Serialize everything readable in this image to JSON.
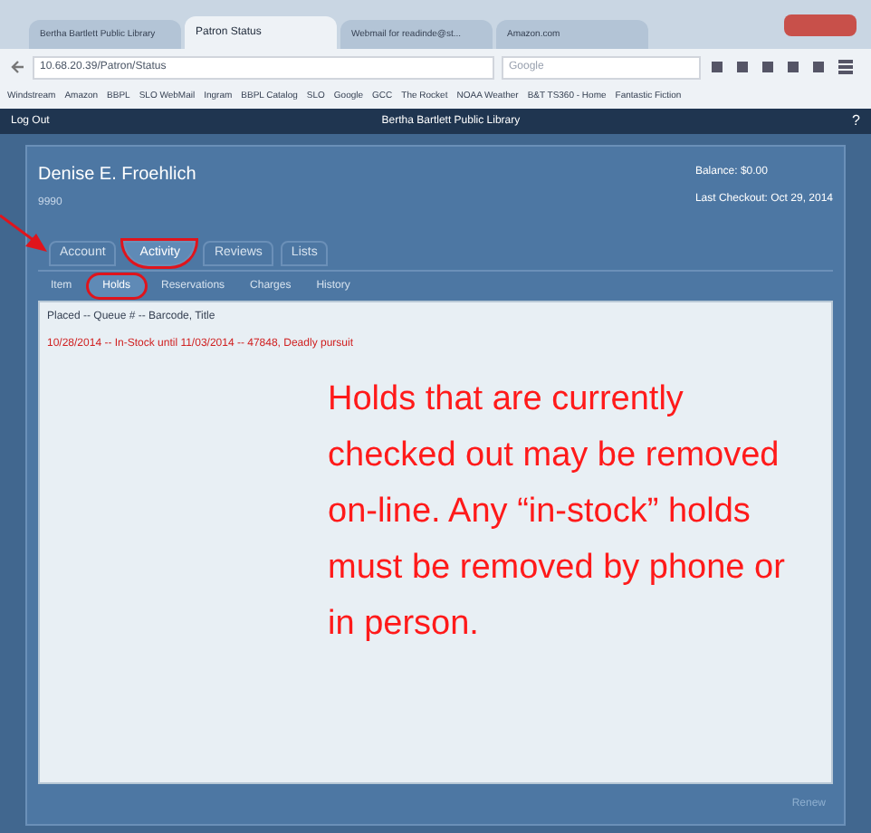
{
  "browser": {
    "tabs": [
      {
        "label": "Bertha Bartlett Public Library",
        "selected": false
      },
      {
        "label": "Patron Status",
        "selected": true
      },
      {
        "label": "Webmail for readinde@st...",
        "selected": false
      },
      {
        "label": "Amazon.com",
        "selected": false
      }
    ],
    "address": "10.68.20.39/Patron/Status",
    "search_placeholder": "Google",
    "bookmarks": [
      "Windstream",
      "Amazon",
      "BBPL",
      "SLO WebMail",
      "Ingram",
      "BBPL Catalog",
      "SLO",
      "Google",
      "GCC",
      "The Rocket",
      "NOAA Weather",
      "B&T TS360 - Home",
      "Fantastic Fiction"
    ]
  },
  "app_bar": {
    "logout": "Log Out",
    "title": "Bertha Bartlett Public Library",
    "help": "?"
  },
  "patron": {
    "name": "Denise E. Froehlich",
    "id": "9990",
    "balance": "Balance: $0.00",
    "last_checkout": "Last Checkout: Oct 29, 2014"
  },
  "tabs": [
    {
      "label": "Account",
      "selected": false,
      "circled": false
    },
    {
      "label": "Activity",
      "selected": true,
      "circled": true
    },
    {
      "label": "Reviews",
      "selected": false,
      "circled": false
    },
    {
      "label": "Lists",
      "selected": false,
      "circled": false
    }
  ],
  "subtabs": [
    {
      "label": "Item",
      "selected": false,
      "circled": false
    },
    {
      "label": "Holds",
      "selected": true,
      "circled": true
    },
    {
      "label": "Reservations",
      "selected": false,
      "circled": false
    },
    {
      "label": "Charges",
      "selected": false,
      "circled": false
    },
    {
      "label": "History",
      "selected": false,
      "circled": false
    }
  ],
  "holds": {
    "header": "Placed -- Queue # -- Barcode, Title",
    "rows": [
      "10/28/2014 -- In-Stock until 11/03/2014 -- 47848, Deadly pursuit"
    ]
  },
  "callout": "Holds that are currently checked out may be removed on-line. Any “in-stock” holds must be removed by phone or in person.",
  "footer_button": "Renew"
}
